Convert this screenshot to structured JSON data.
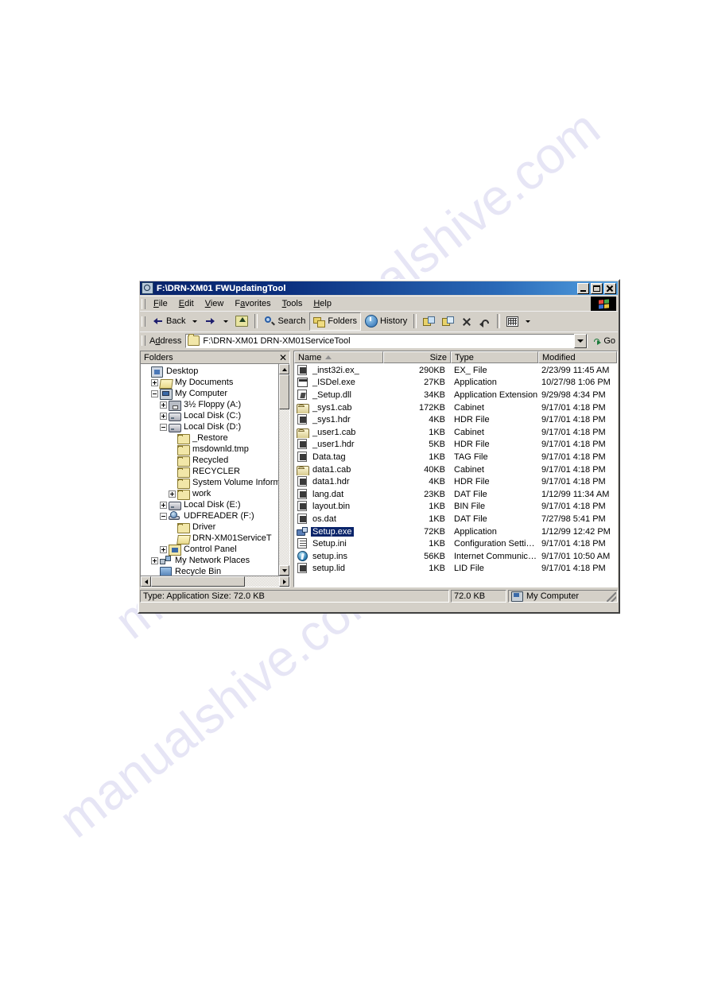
{
  "page": {
    "watermark_text": "manualshive.com"
  },
  "window": {
    "title": "F:\\DRN-XM01 FWUpdatingTool",
    "app_icon": "explorer-icon",
    "buttons": {
      "minimize": "Minimize",
      "maximize": "Maximize",
      "close": "Close"
    }
  },
  "menu": {
    "items": [
      {
        "label": "File",
        "accel": "F"
      },
      {
        "label": "Edit",
        "accel": "E"
      },
      {
        "label": "View",
        "accel": "V"
      },
      {
        "label": "Favorites",
        "accel": "a"
      },
      {
        "label": "Tools",
        "accel": "T"
      },
      {
        "label": "Help",
        "accel": "H"
      }
    ],
    "brand_logo": "windows-flag-icon"
  },
  "toolbar": {
    "back": "Back",
    "forward": "",
    "up": "",
    "search": "Search",
    "folders": "Folders",
    "history": "History",
    "move_to": "",
    "copy_to": "",
    "delete": "",
    "undo": "",
    "views": "",
    "pressed_button": "Folders"
  },
  "address": {
    "label": "Address",
    "value": "F:\\DRN-XM01 DRN-XM01ServiceTool",
    "go_label": "Go",
    "folder_icon": "folder-icon"
  },
  "tree": {
    "header": "Folders",
    "close_label": "✕",
    "items": [
      {
        "label": "Desktop",
        "indent": 0,
        "node": "none",
        "icon": "desktop-icon"
      },
      {
        "label": "My Documents",
        "indent": 1,
        "node": "plus",
        "icon": "mydocs-icon"
      },
      {
        "label": "My Computer",
        "indent": 1,
        "node": "minus",
        "icon": "mycomputer-icon"
      },
      {
        "label": "3½ Floppy (A:)",
        "indent": 2,
        "node": "plus",
        "icon": "floppy-icon"
      },
      {
        "label": "Local Disk (C:)",
        "indent": 2,
        "node": "plus",
        "icon": "harddisk-icon"
      },
      {
        "label": "Local Disk (D:)",
        "indent": 2,
        "node": "minus",
        "icon": "harddisk-icon"
      },
      {
        "label": "_Restore",
        "indent": 3,
        "node": "none",
        "icon": "folder-icon"
      },
      {
        "label": "msdownld.tmp",
        "indent": 3,
        "node": "none",
        "icon": "folder-icon"
      },
      {
        "label": "Recycled",
        "indent": 3,
        "node": "none",
        "icon": "folder-icon"
      },
      {
        "label": "RECYCLER",
        "indent": 3,
        "node": "none",
        "icon": "folder-icon"
      },
      {
        "label": "System Volume Inform",
        "indent": 3,
        "node": "none",
        "icon": "folder-icon"
      },
      {
        "label": "work",
        "indent": 3,
        "node": "plus",
        "icon": "folder-icon"
      },
      {
        "label": "Local Disk (E:)",
        "indent": 2,
        "node": "plus",
        "icon": "harddisk-icon"
      },
      {
        "label": "UDFREADER (F:)",
        "indent": 2,
        "node": "minus",
        "icon": "cdrom-icon"
      },
      {
        "label": "Driver",
        "indent": 3,
        "node": "none",
        "icon": "folder-icon"
      },
      {
        "label": "DRN-XM01ServiceT",
        "indent": 3,
        "node": "none",
        "icon": "folder-open-icon"
      },
      {
        "label": "Control Panel",
        "indent": 2,
        "node": "plus",
        "icon": "controlpanel-icon"
      },
      {
        "label": "My Network Places",
        "indent": 1,
        "node": "plus",
        "icon": "network-icon"
      },
      {
        "label": "Recycle Bin",
        "indent": 1,
        "node": "none",
        "icon": "recyclebin-icon"
      }
    ]
  },
  "filelist": {
    "columns": [
      {
        "label": "Name",
        "sorted": true
      },
      {
        "label": "Size",
        "sorted": false
      },
      {
        "label": "Type",
        "sorted": false
      },
      {
        "label": "Modified",
        "sorted": false
      }
    ],
    "sort_indicator": "ascending",
    "rows": [
      {
        "name": "_inst32i.ex_",
        "size": "290KB",
        "type": "EX_ File",
        "modified": "2/23/99 11:45 AM",
        "icon": "generic-file-icon",
        "selected": false
      },
      {
        "name": "_ISDel.exe",
        "size": "27KB",
        "type": "Application",
        "modified": "10/27/98 1:06 PM",
        "icon": "exe-file-icon",
        "selected": false
      },
      {
        "name": "_Setup.dll",
        "size": "34KB",
        "type": "Application Extension",
        "modified": "9/29/98 4:34 PM",
        "icon": "dll-file-icon",
        "selected": false
      },
      {
        "name": "_sys1.cab",
        "size": "172KB",
        "type": "Cabinet",
        "modified": "9/17/01 4:18 PM",
        "icon": "cabinet-file-icon",
        "selected": false
      },
      {
        "name": "_sys1.hdr",
        "size": "4KB",
        "type": "HDR File",
        "modified": "9/17/01 4:18 PM",
        "icon": "generic-file-icon",
        "selected": false
      },
      {
        "name": "_user1.cab",
        "size": "1KB",
        "type": "Cabinet",
        "modified": "9/17/01 4:18 PM",
        "icon": "cabinet-file-icon",
        "selected": false
      },
      {
        "name": "_user1.hdr",
        "size": "5KB",
        "type": "HDR File",
        "modified": "9/17/01 4:18 PM",
        "icon": "generic-file-icon",
        "selected": false
      },
      {
        "name": "Data.tag",
        "size": "1KB",
        "type": "TAG File",
        "modified": "9/17/01 4:18 PM",
        "icon": "generic-file-icon",
        "selected": false
      },
      {
        "name": "data1.cab",
        "size": "40KB",
        "type": "Cabinet",
        "modified": "9/17/01 4:18 PM",
        "icon": "cabinet-file-icon",
        "selected": false
      },
      {
        "name": "data1.hdr",
        "size": "4KB",
        "type": "HDR File",
        "modified": "9/17/01 4:18 PM",
        "icon": "generic-file-icon",
        "selected": false
      },
      {
        "name": "lang.dat",
        "size": "23KB",
        "type": "DAT File",
        "modified": "1/12/99 11:34 AM",
        "icon": "generic-file-icon",
        "selected": false
      },
      {
        "name": "layout.bin",
        "size": "1KB",
        "type": "BIN File",
        "modified": "9/17/01 4:18 PM",
        "icon": "generic-file-icon",
        "selected": false
      },
      {
        "name": "os.dat",
        "size": "1KB",
        "type": "DAT File",
        "modified": "7/27/98 5:41 PM",
        "icon": "generic-file-icon",
        "selected": false
      },
      {
        "name": "Setup.exe",
        "size": "72KB",
        "type": "Application",
        "modified": "1/12/99 12:42 PM",
        "icon": "setup-exe-icon",
        "selected": true
      },
      {
        "name": "Setup.ini",
        "size": "1KB",
        "type": "Configuration Settings",
        "modified": "9/17/01 4:18 PM",
        "icon": "ini-file-icon",
        "selected": false
      },
      {
        "name": "setup.ins",
        "size": "56KB",
        "type": "Internet Communicati...",
        "modified": "9/17/01 10:50 AM",
        "icon": "ins-file-icon",
        "selected": false
      },
      {
        "name": "setup.lid",
        "size": "1KB",
        "type": "LID File",
        "modified": "9/17/01 4:18 PM",
        "icon": "generic-file-icon",
        "selected": false
      }
    ]
  },
  "statusbar": {
    "info": "Type: Application Size: 72.0 KB",
    "size": "72.0 KB",
    "location": "My Computer",
    "location_icon": "mycomputer-icon"
  },
  "colors": {
    "window_face": "#d4d0c8",
    "title_active": "#0a246a",
    "selection": "#0a246a",
    "list_background": "#ffffff"
  }
}
